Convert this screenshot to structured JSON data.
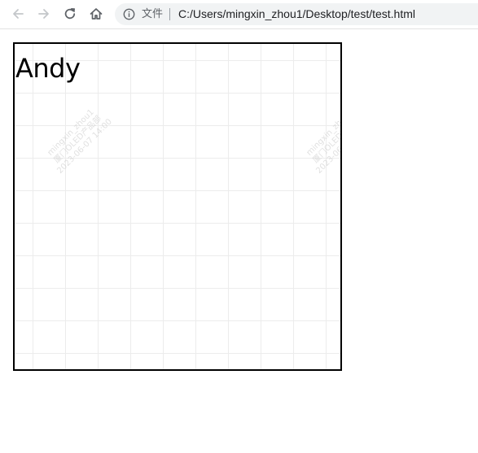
{
  "browser": {
    "nav": {
      "back_icon": "arrow-left-icon",
      "forward_icon": "arrow-right-icon",
      "reload_icon": "reload-icon",
      "home_icon": "home-icon"
    },
    "omnibox": {
      "info_icon": "info-icon",
      "info_label": "文件",
      "url": "C:/Users/mingxin_zhou1/Desktop/test/test.html"
    }
  },
  "page": {
    "name_text": "Andy",
    "border_color": "#000000",
    "grid_color": "#ececec"
  },
  "watermark": {
    "line1": "mingxin_zhou1",
    "line2": "厦门OLED产品部",
    "line3": "2023-06-07 14:00"
  }
}
